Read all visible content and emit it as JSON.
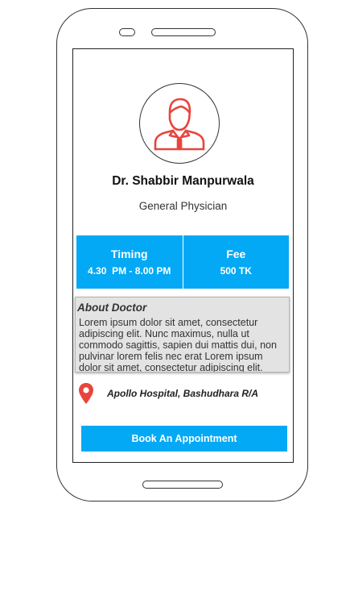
{
  "doctor": {
    "name": "Dr. Shabbir Manpurwala",
    "specialty": "General Physician",
    "avatar_icon": "doctor-avatar-icon"
  },
  "info": {
    "timing_label": "Timing",
    "timing_value": "4.30  PM - 8.00 PM",
    "fee_label": "Fee",
    "fee_value": "500 TK"
  },
  "about": {
    "title": "About Doctor",
    "text": "Lorem ipsum dolor sit amet, consectetur adipiscing elit. Nunc maximus, nulla ut commodo sagittis, sapien dui mattis dui, non pulvinar lorem felis nec erat Lorem ipsum dolor sit amet, consectetur adipiscing elit."
  },
  "location": {
    "icon": "map-pin-icon",
    "text": "Apollo Hospital, Bashudhara R/A"
  },
  "action": {
    "book_label": "Book An Appointment"
  },
  "colors": {
    "accent": "#03a9f4",
    "icon_red": "#e8453c"
  }
}
